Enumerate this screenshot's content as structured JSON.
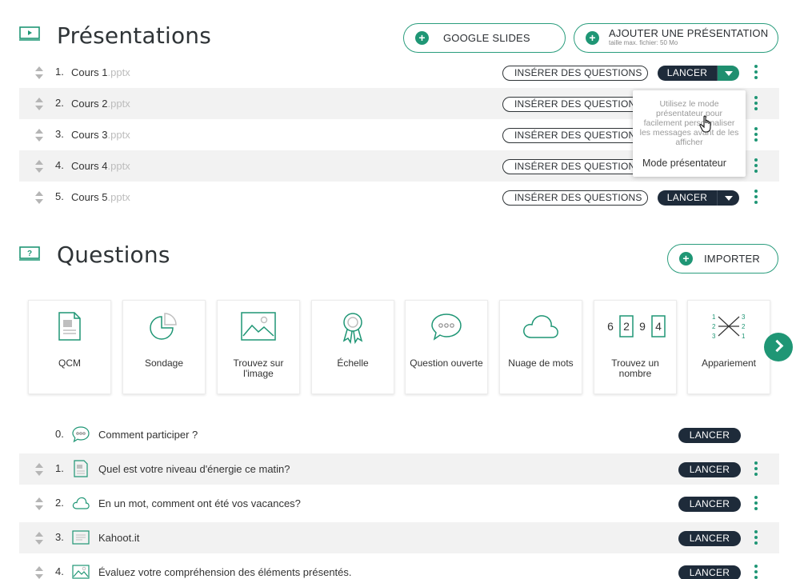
{
  "presentations": {
    "title": "Présentations",
    "google_slides_label": "GOOGLE SLIDES",
    "add_label": "AJOUTER UNE PRÉSENTATION",
    "add_sublabel": "taille max. fichier: 50 Mo",
    "insert_label": "INSÉRER DES QUESTIONS",
    "launch_label": "LANCER",
    "items": [
      {
        "num": "1.",
        "name": "Cours 1",
        "ext": ".pptx"
      },
      {
        "num": "2.",
        "name": "Cours 2",
        "ext": ".pptx"
      },
      {
        "num": "3.",
        "name": "Cours 3",
        "ext": ".pptx"
      },
      {
        "num": "4.",
        "name": "Cours 4",
        "ext": ".pptx"
      },
      {
        "num": "5.",
        "name": "Cours 5",
        "ext": ".pptx"
      }
    ],
    "tooltip": {
      "text": "Utilisez le mode présentateur pour facilement personnaliser les messages avant de les afficher",
      "item": "Mode présentateur"
    }
  },
  "questions": {
    "title": "Questions",
    "import_label": "IMPORTER",
    "types": [
      {
        "label": "QCM",
        "icon": "document-icon"
      },
      {
        "label": "Sondage",
        "icon": "pie-chart-icon"
      },
      {
        "label": "Trouvez sur l'image",
        "icon": "image-icon"
      },
      {
        "label": "Échelle",
        "icon": "award-icon"
      },
      {
        "label": "Question ouverte",
        "icon": "speech-bubble-icon"
      },
      {
        "label": "Nuage de mots",
        "icon": "cloud-icon"
      },
      {
        "label": "Trouvez un nombre",
        "icon": "number-boxes-icon",
        "digits": [
          "6",
          "2",
          "9",
          "4"
        ]
      },
      {
        "label": "Appariement",
        "icon": "matching-icon"
      }
    ],
    "launch_label": "LANCER",
    "items": [
      {
        "num": "0.",
        "text": "Comment participer ?",
        "icon": "speech-bubble-icon"
      },
      {
        "num": "1.",
        "text": "Quel est votre niveau d'énergie ce matin?",
        "icon": "document-icon"
      },
      {
        "num": "2.",
        "text": "En un mot, comment ont été vos vacances?",
        "icon": "cloud-icon"
      },
      {
        "num": "3.",
        "text": "Kahoot.it",
        "icon": "slide-icon"
      },
      {
        "num": "4.",
        "text": "Évaluez votre compréhension des éléments présentés.",
        "icon": "image-icon"
      }
    ]
  },
  "colors": {
    "accent": "#1f9675",
    "dark": "#1e2b3a",
    "row_shade": "#f2f2f2"
  }
}
